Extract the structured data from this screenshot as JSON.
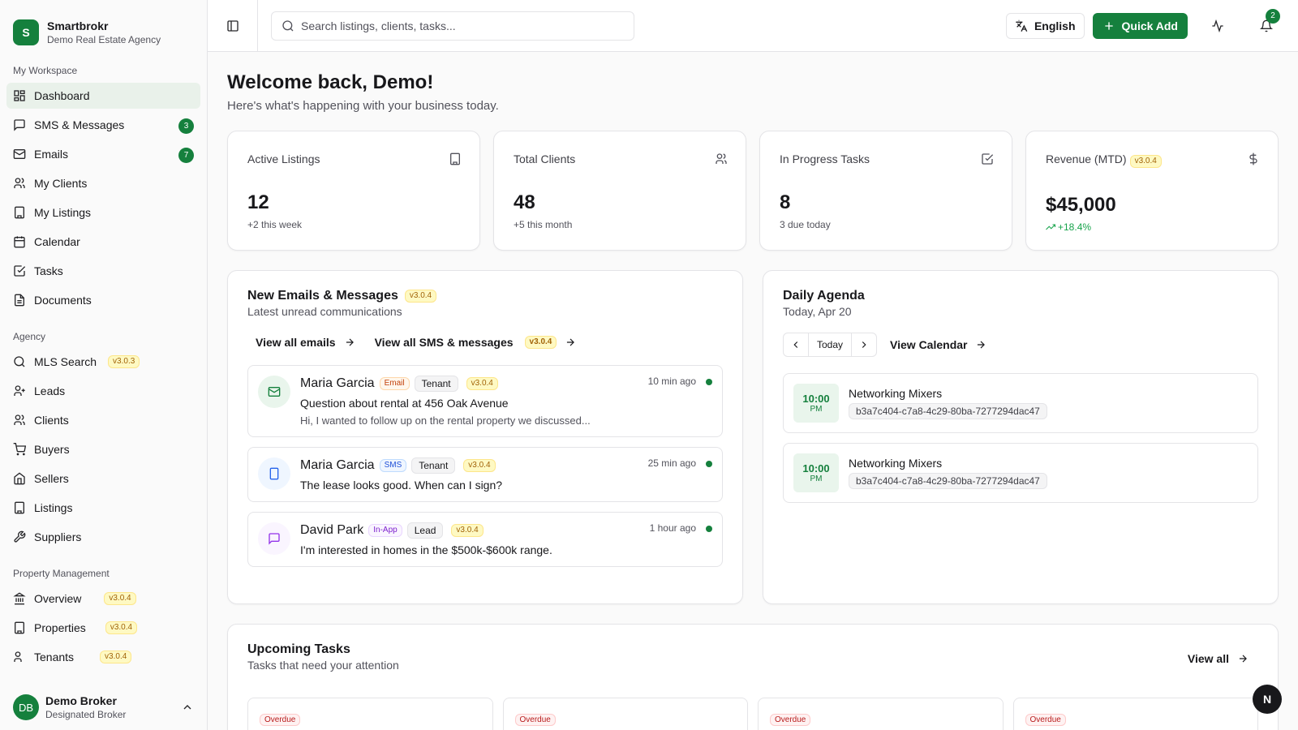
{
  "brand": {
    "initial": "S",
    "name": "Smartbrokr",
    "agency": "Demo Real Estate Agency"
  },
  "sidebar": {
    "sections": [
      {
        "title": "My Workspace",
        "items": [
          {
            "label": "Dashboard",
            "icon": "dashboard-icon",
            "active": true
          },
          {
            "label": "SMS & Messages",
            "icon": "message-icon",
            "count": "3"
          },
          {
            "label": "Emails",
            "icon": "mail-icon",
            "count": "7"
          },
          {
            "label": "My Clients",
            "icon": "users-icon"
          },
          {
            "label": "My Listings",
            "icon": "building-icon"
          },
          {
            "label": "Calendar",
            "icon": "calendar-icon"
          },
          {
            "label": "Tasks",
            "icon": "check-square-icon"
          },
          {
            "label": "Documents",
            "icon": "document-icon"
          }
        ]
      },
      {
        "title": "Agency",
        "items": [
          {
            "label": "MLS Search",
            "icon": "search-icon",
            "version": "v3.0.3"
          },
          {
            "label": "Leads",
            "icon": "user-plus-icon"
          },
          {
            "label": "Clients",
            "icon": "users-icon"
          },
          {
            "label": "Buyers",
            "icon": "cart-icon"
          },
          {
            "label": "Sellers",
            "icon": "home-icon"
          },
          {
            "label": "Listings",
            "icon": "building-icon"
          },
          {
            "label": "Suppliers",
            "icon": "wrench-icon"
          }
        ]
      },
      {
        "title": "Property Management",
        "items": [
          {
            "label": "Overview",
            "icon": "landmark-icon",
            "version": "v3.0.4"
          },
          {
            "label": "Properties",
            "icon": "building-icon",
            "version": "v3.0.4"
          },
          {
            "label": "Tenants",
            "icon": "users-icon",
            "version": "v3.0.4"
          }
        ]
      }
    ],
    "footer": {
      "initials": "DB",
      "name": "Demo Broker",
      "role": "Designated Broker"
    }
  },
  "header": {
    "search_placeholder": "Search listings, clients, tasks...",
    "language": "English",
    "quick_add": "Quick Add",
    "notifications": "2"
  },
  "welcome": {
    "title": "Welcome back, Demo!",
    "subtitle": "Here's what's happening with your business today."
  },
  "stats": [
    {
      "label": "Active Listings",
      "value": "12",
      "note": "+2 this week",
      "icon": "building-icon"
    },
    {
      "label": "Total Clients",
      "value": "48",
      "note": "+5 this month",
      "icon": "users-icon"
    },
    {
      "label": "In Progress Tasks",
      "value": "8",
      "note": "3 due today",
      "icon": "check-square-icon"
    },
    {
      "label": "Revenue (MTD)",
      "version": "v3.0.4",
      "value": "$45,000",
      "note": "+18.4%",
      "icon": "dollar-icon"
    }
  ],
  "messages_card": {
    "title": "New Emails & Messages",
    "version": "v3.0.4",
    "subtitle": "Latest unread communications",
    "link_emails": "View all emails",
    "link_sms": "View all SMS & messages",
    "link_sms_version": "v3.0.4",
    "items": [
      {
        "name": "Maria Garcia",
        "channel": "Email",
        "role": "Tenant",
        "version": "v3.0.4",
        "time": "10 min ago",
        "subject": "Question about rental at 456 Oak Avenue",
        "preview": "Hi, I wanted to follow up on the rental property we discussed..."
      },
      {
        "name": "Maria Garcia",
        "channel": "SMS",
        "role": "Tenant",
        "version": "v3.0.4",
        "time": "25 min ago",
        "subject": "The lease looks good. When can I sign?"
      },
      {
        "name": "David Park",
        "channel": "In-App",
        "role": "Lead",
        "version": "v3.0.4",
        "time": "1 hour ago",
        "subject": "I'm interested in homes in the $500k-$600k range."
      }
    ]
  },
  "agenda": {
    "title": "Daily Agenda",
    "date": "Today, Apr 20",
    "today_label": "Today",
    "view_calendar": "View Calendar",
    "items": [
      {
        "time": "10:00",
        "ampm": "PM",
        "title": "Networking Mixers",
        "id": "b3a7c404-c7a8-4c29-80ba-7277294dac47"
      },
      {
        "time": "10:00",
        "ampm": "PM",
        "title": "Networking Mixers",
        "id": "b3a7c404-c7a8-4c29-80ba-7277294dac47"
      }
    ]
  },
  "tasks": {
    "title": "Upcoming Tasks",
    "subtitle": "Tasks that need your attention",
    "view_all": "View all",
    "cards": [
      "Overdue",
      "Overdue",
      "Overdue",
      "Overdue"
    ]
  },
  "fab_label": "N"
}
